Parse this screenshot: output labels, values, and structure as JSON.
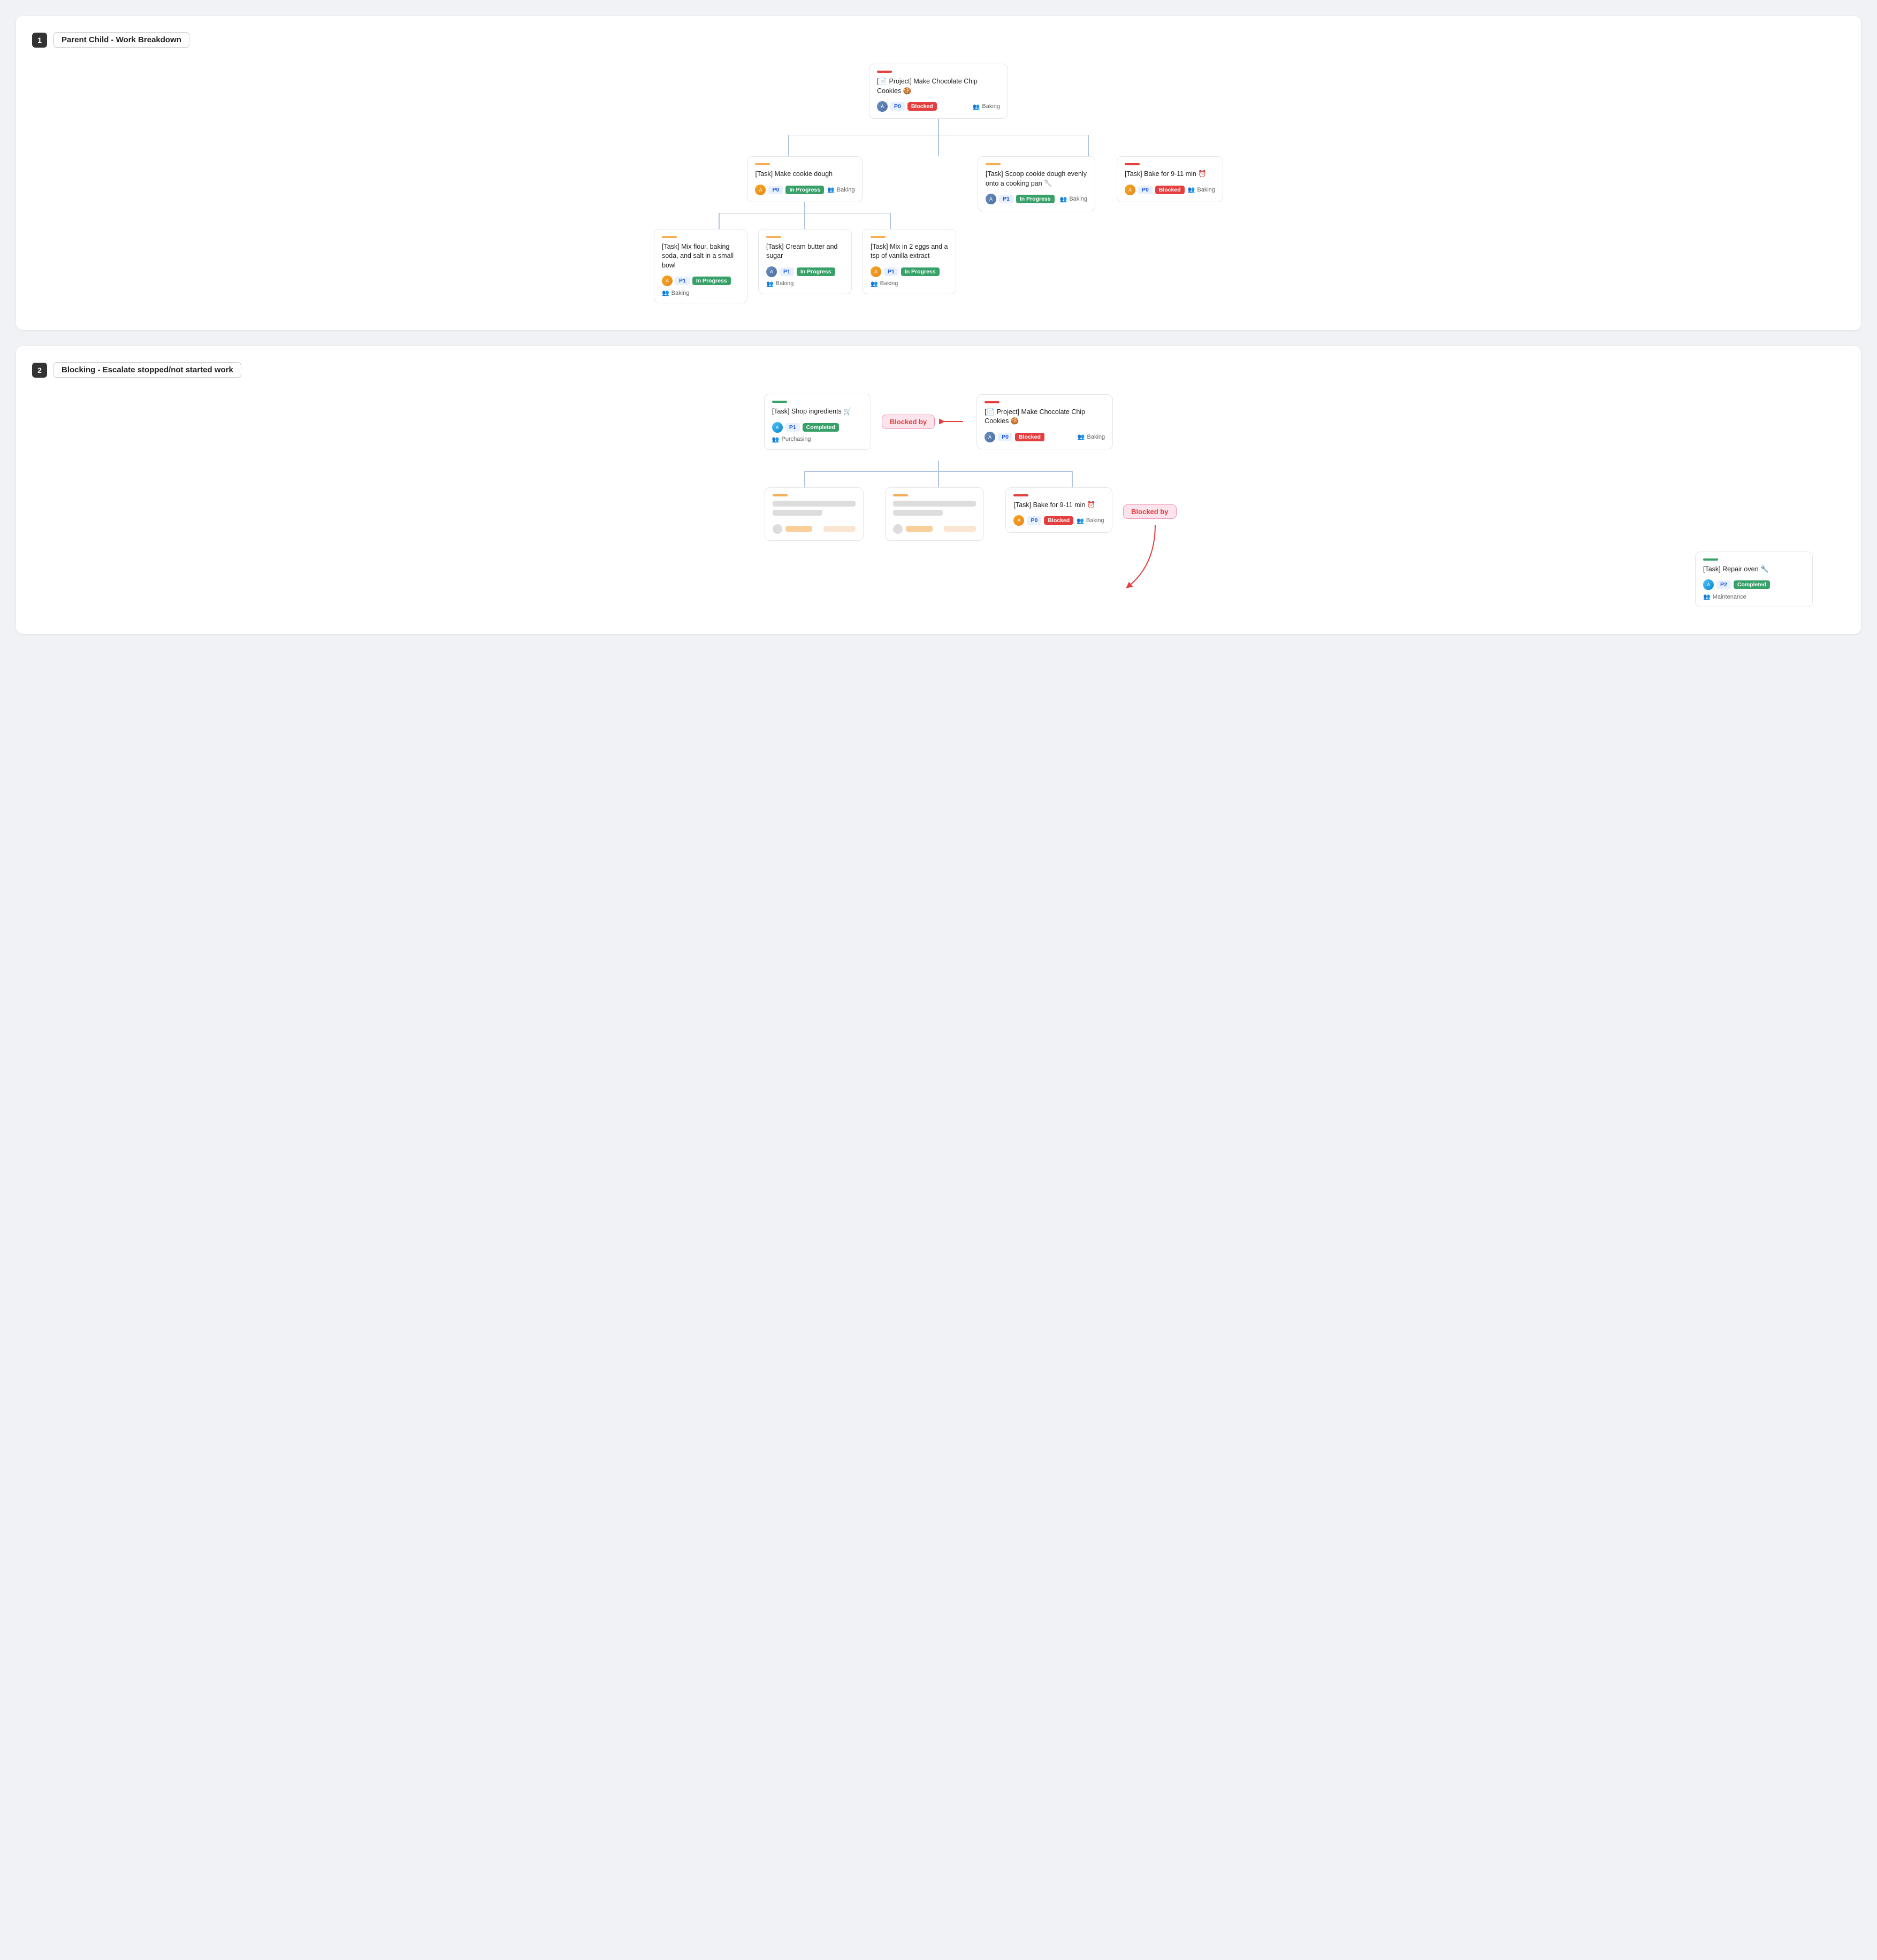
{
  "section1": {
    "number": "1",
    "title": "Parent Child - Work Breakdown",
    "root": {
      "accent": "#e53e3e",
      "icon": "📄",
      "title": "[📄 Project] Make Chocolate Chip Cookies 🍪",
      "avatar_color": "blue",
      "priority": "P0",
      "status": "Blocked",
      "status_color": "blocked",
      "team": "Baking"
    },
    "level1": [
      {
        "accent": "#f6ad55",
        "title": "[Task] Make cookie dough",
        "avatar_color": "orange",
        "priority": "P0",
        "status": "In Progress",
        "status_color": "inprogress",
        "team": "Baking",
        "has_children": true
      },
      {
        "accent": "#f6ad55",
        "title": "[Task] Scoop cookie dough evenly onto a cooking pan 🥄",
        "avatar_color": "blue",
        "priority": "P1",
        "status": "In Progress",
        "status_color": "inprogress",
        "team": "Baking",
        "has_children": false
      },
      {
        "accent": "#e53e3e",
        "title": "[Task] Bake for 9-11 min ⏰",
        "avatar_color": "orange",
        "priority": "P0",
        "status": "Blocked",
        "status_color": "blocked",
        "team": "Baking",
        "has_children": false
      }
    ],
    "level2": [
      {
        "accent": "#f6ad55",
        "title": "[Task] Mix flour, baking soda, and salt in a small bowl",
        "avatar_color": "orange",
        "priority": "P1",
        "status": "In Progress",
        "status_color": "inprogress",
        "team": "Baking"
      },
      {
        "accent": "#f6ad55",
        "title": "[Task] Cream butter and sugar",
        "avatar_color": "blue",
        "priority": "P1",
        "status": "In Progress",
        "status_color": "inprogress",
        "team": "Baking"
      },
      {
        "accent": "#f6ad55",
        "title": "[Task] Mix in 2 eggs and a tsp of vanilla extract",
        "avatar_color": "orange",
        "priority": "P1",
        "status": "In Progress",
        "status_color": "inprogress",
        "team": "Baking"
      }
    ]
  },
  "section2": {
    "number": "2",
    "title": "Blocking - Escalate stopped/not started work",
    "shop": {
      "accent": "#38a169",
      "title": "[Task] Shop ingredients 🛒",
      "avatar_color": "blue2",
      "priority": "P1",
      "status": "Completed",
      "status_color": "completed",
      "team": "Purchasing"
    },
    "blocked_by_label": "Blocked by",
    "root": {
      "accent": "#e53e3e",
      "icon": "📄",
      "title": "[📄 Project] Make Chocolate Chip Cookies 🍪",
      "avatar_color": "blue",
      "priority": "P0",
      "status": "Blocked",
      "status_color": "blocked",
      "team": "Baking"
    },
    "bake_task": {
      "accent": "#e53e3e",
      "title": "[Task] Bake for 9-11 min ⏰",
      "avatar_color": "orange",
      "priority": "P0",
      "status": "Blocked",
      "status_color": "blocked",
      "team": "Baking"
    },
    "repair_task": {
      "accent": "#38a169",
      "title": "[Task] Repair oven 🔧",
      "avatar_color": "blue2",
      "priority": "P2",
      "status": "Completed",
      "status_color": "completed",
      "team": "Maintenance"
    },
    "blocked_by_label2": "Blocked by"
  }
}
